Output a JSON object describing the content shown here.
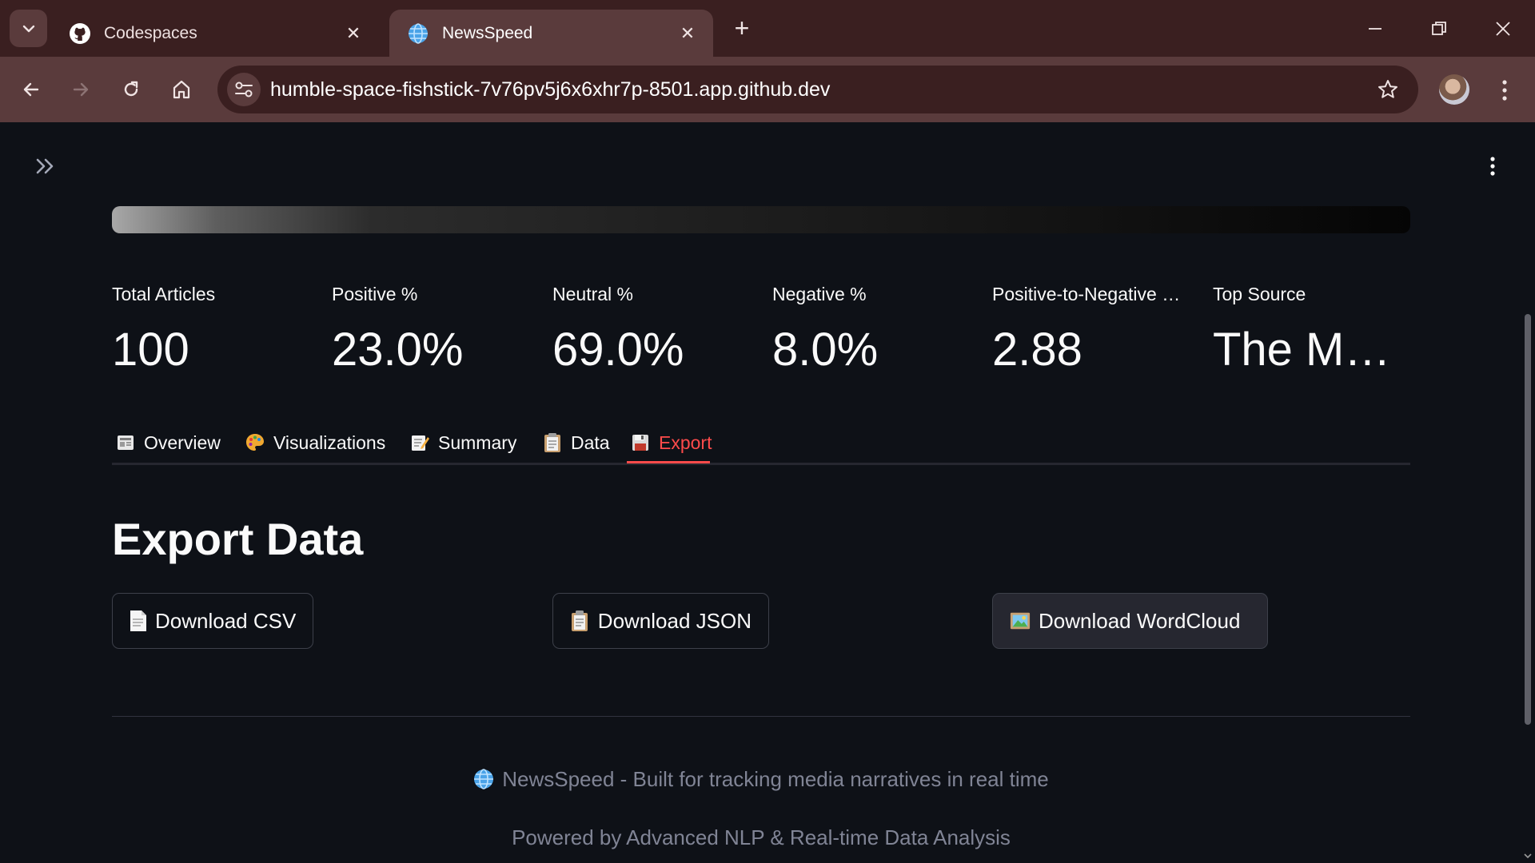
{
  "browser": {
    "tabs": [
      {
        "title": "Codespaces",
        "icon": "github-icon",
        "active": false
      },
      {
        "title": "NewsSpeed",
        "icon": "globe-icon",
        "active": true
      }
    ],
    "close_glyph": "✕",
    "new_tab_glyph": "+",
    "url": "humble-space-fishstick-7v76pv5j6x6xhr7p-8501.app.github.dev"
  },
  "metrics": [
    {
      "label": "Total Articles",
      "value": "100"
    },
    {
      "label": "Positive %",
      "value": "23.0%"
    },
    {
      "label": "Neutral %",
      "value": "69.0%"
    },
    {
      "label": "Negative %",
      "value": "8.0%"
    },
    {
      "label": "Positive-to-Negative …",
      "value": "2.88"
    },
    {
      "label": "Top Source",
      "value": "The M…"
    }
  ],
  "tabs": [
    {
      "label": "Overview",
      "icon": "newspaper-icon"
    },
    {
      "label": "Visualizations",
      "icon": "palette-icon"
    },
    {
      "label": "Summary",
      "icon": "memo-icon"
    },
    {
      "label": "Data",
      "icon": "clipboard-icon"
    },
    {
      "label": "Export",
      "icon": "floppy-disk-icon",
      "selected": true
    }
  ],
  "export": {
    "title": "Export Data",
    "buttons": [
      {
        "label": "Download CSV",
        "icon": "page-icon"
      },
      {
        "label": "Download JSON",
        "icon": "clipboard-icon"
      },
      {
        "label": "Download WordCloud",
        "icon": "picture-icon"
      }
    ]
  },
  "footer": {
    "line1": "NewsSpeed - Built for tracking media narratives in real time",
    "line2": "Powered by Advanced NLP & Real-time Data Analysis"
  },
  "colors": {
    "accent": "#ff4b4b",
    "background": "#0e1117",
    "browser_frame": "#3a1f20",
    "browser_toolbar": "#5a3b3c"
  }
}
